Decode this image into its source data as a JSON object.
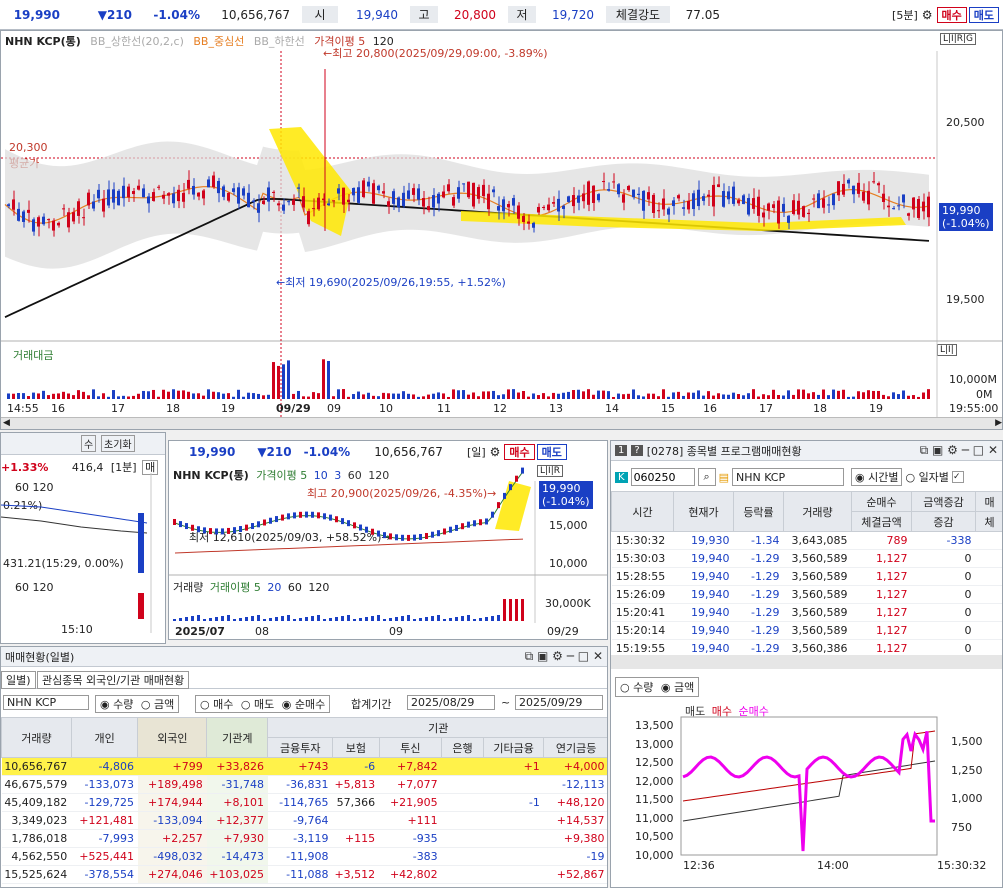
{
  "topbar": {
    "price": "19,990",
    "change": "▼210",
    "change_pct": "-1.04%",
    "volume": "10,656,767",
    "open_label": "시",
    "open": "19,940",
    "high_label": "고",
    "high": "20,800",
    "low_label": "저",
    "low": "19,720",
    "strength_label": "체결강도",
    "strength": "77.05",
    "interval": "[5분]",
    "buy": "매수",
    "sell": "매도"
  },
  "main_chart": {
    "legend_name": "NHN KCP(통)",
    "legend_bb_upper": "BB_상한선(20,2,c)",
    "legend_bb_mid": "BB_중심선",
    "legend_bb_lower": "BB_하한선",
    "legend_ma": "가격이평 5",
    "legend_ma2": "120",
    "max_annot": "←최고 20,800(2025/09/29,09:00, -3.89%)",
    "min_annot": "←최저 19,690(2025/09/26,19:55, +1.52%)",
    "ref_price": "20,300",
    "ref_label": "평균가",
    "y_ticks": [
      "20,500",
      "19,500"
    ],
    "last_price": "19,990",
    "last_pct": "(-1.04%)",
    "vol_label": "거래대금",
    "vol_ticks": [
      "10,000M",
      "0M"
    ],
    "x_labels": [
      "14:55",
      "16",
      "17",
      "18",
      "19",
      "09/29",
      "09",
      "10",
      "11",
      "12",
      "13",
      "14",
      "15",
      "16",
      "17",
      "18",
      "19",
      "19:55:00"
    ],
    "lir": "L|I|R|G",
    "lir2": "L|I|"
  },
  "left_mini": {
    "pct": "+1.33%",
    "value": "416,4",
    "interval": "[1분]",
    "sell": "매",
    "legend1": "60",
    "legend2": "120",
    "pct2": "0.21%)",
    "note": "431.21(15:29, 0.00%)",
    "legend3": "60",
    "legend4": "120",
    "x_label": "15:10",
    "tab1": "수",
    "tab2": "초기화"
  },
  "daily_chart": {
    "price": "19,990",
    "change": "▼210",
    "change_pct": "-1.04%",
    "volume": "10,656,767",
    "interval": "[일]",
    "buy": "매수",
    "sell": "매도",
    "legend_name": "NHN KCP(통)",
    "legend_ma": "가격이평 5",
    "legend_10": "10",
    "legend_3": "3",
    "legend_60": "60",
    "legend_120": "120",
    "max_annot": "최고 20,900(2025/09/26, -4.35%)→",
    "min_annot": "최저 12,610(2025/09/03, +58.52%)→",
    "y_ticks": [
      "15,000",
      "10,000"
    ],
    "last_price": "19,990",
    "last_pct": "(-1.04%)",
    "vol_label": "거래량",
    "vol_ma": "거래이평 5",
    "vol_20": "20",
    "vol_60": "60",
    "vol_120": "120",
    "vol_tick": "30,000K",
    "x_labels": [
      "2025/07",
      "08",
      "09",
      "09/29"
    ],
    "lir": "L|I|R"
  },
  "program": {
    "title": "[0278] 종목별 프로그램매매현황",
    "code": "060250",
    "name": "NHN KCP",
    "radio_time": "시간별",
    "radio_day": "일자별",
    "headers": [
      "시간",
      "현재가",
      "등락률",
      "거래량",
      "순매수",
      "금액증감"
    ],
    "subheaders": [
      "체결금액",
      "증감"
    ],
    "extra_header": "매",
    "extra_sub": "체",
    "rows": [
      [
        "15:30:32",
        "19,930",
        "-1.34",
        "3,643,085",
        "789",
        "-338"
      ],
      [
        "15:30:03",
        "19,940",
        "-1.29",
        "3,560,589",
        "1,127",
        "0"
      ],
      [
        "15:28:55",
        "19,940",
        "-1.29",
        "3,560,589",
        "1,127",
        "0"
      ],
      [
        "15:26:09",
        "19,940",
        "-1.29",
        "3,560,589",
        "1,127",
        "0"
      ],
      [
        "15:20:41",
        "19,940",
        "-1.29",
        "3,560,589",
        "1,127",
        "0"
      ],
      [
        "15:20:14",
        "19,940",
        "-1.29",
        "3,560,589",
        "1,127",
        "0"
      ],
      [
        "15:19:55",
        "19,940",
        "-1.29",
        "3,560,386",
        "1,127",
        "0"
      ]
    ],
    "radio_qty": "수량",
    "radio_amt": "금액",
    "legend_sell": "매도",
    "legend_buy": "매수",
    "legend_net": "순매수",
    "left_ticks": [
      "13,500",
      "13,000",
      "12,500",
      "12,000",
      "11,500",
      "11,000",
      "10,500",
      "10,000"
    ],
    "right_ticks": [
      "1,500",
      "1,250",
      "1,000",
      "750"
    ],
    "x_labels": [
      "12:36",
      "14:00",
      "15:30:32"
    ]
  },
  "investor": {
    "title": "매매현황(일별)",
    "tab1": "일별)",
    "tab2": "관심종목 외국인/기관 매매현황",
    "name": "NHN KCP",
    "radio_qty": "수량",
    "radio_amt": "금액",
    "radio_buy": "매수",
    "radio_sell": "매도",
    "radio_net": "순매수",
    "period_label": "합계기간",
    "date_from": "2025/08/29",
    "tilde": "~",
    "date_to": "2025/09/29",
    "group_label": "기관",
    "headers": [
      "거래량",
      "개인",
      "외국인",
      "기관계",
      "금융투자",
      "보험",
      "투신",
      "은행",
      "기타금융",
      "연기금등"
    ],
    "rows": [
      [
        "10,656,767",
        "-4,806",
        "+799",
        "+33,826",
        "+743",
        "-6",
        "+7,842",
        "",
        "+1",
        "+4,000"
      ],
      [
        "46,675,579",
        "-133,073",
        "+189,498",
        "-31,748",
        "-36,831",
        "+5,813",
        "+7,077",
        "",
        "",
        "-12,113"
      ],
      [
        "45,409,182",
        "-129,725",
        "+174,944",
        "+8,101",
        "-114,765",
        "57,366",
        "+21,905",
        "",
        "-1",
        "+48,120"
      ],
      [
        "3,349,023",
        "+121,481",
        "-133,094",
        "+12,377",
        "-9,764",
        "",
        "+111",
        "",
        "",
        "+14,537"
      ],
      [
        "1,786,018",
        "-7,993",
        "+2,257",
        "+7,930",
        "-3,119",
        "+115",
        "-935",
        "",
        "",
        "+9,380"
      ],
      [
        "4,562,550",
        "+525,441",
        "-498,032",
        "-14,473",
        "-11,908",
        "",
        "-383",
        "",
        "",
        "-19"
      ],
      [
        "15,525,624",
        "-378,554",
        "+274,046",
        "+103,025",
        "-11,088",
        "+3,512",
        "+42,802",
        "",
        "",
        "+52,867"
      ]
    ]
  }
}
